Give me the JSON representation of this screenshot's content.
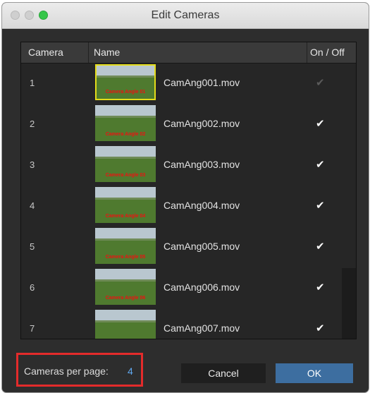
{
  "window": {
    "title": "Edit Cameras"
  },
  "table": {
    "columns": {
      "camera": "Camera",
      "name": "Name",
      "on_off": "On / Off"
    },
    "rows": [
      {
        "camera": "1",
        "name": "CamAng001.mov",
        "thumb_caption": "Camera Angle 01",
        "checked": true,
        "selected": true
      },
      {
        "camera": "2",
        "name": "CamAng002.mov",
        "thumb_caption": "Camera Angle 02",
        "checked": true,
        "selected": false
      },
      {
        "camera": "3",
        "name": "CamAng003.mov",
        "thumb_caption": "Camera Angle 03",
        "checked": true,
        "selected": false
      },
      {
        "camera": "4",
        "name": "CamAng004.mov",
        "thumb_caption": "Camera Angle 04",
        "checked": true,
        "selected": false
      },
      {
        "camera": "5",
        "name": "CamAng005.mov",
        "thumb_caption": "Camera Angle 05",
        "checked": true,
        "selected": false
      },
      {
        "camera": "6",
        "name": "CamAng006.mov",
        "thumb_caption": "Camera Angle 06",
        "checked": true,
        "selected": false
      },
      {
        "camera": "7",
        "name": "CamAng007.mov",
        "thumb_caption": "",
        "checked": true,
        "selected": false
      }
    ]
  },
  "footer": {
    "cameras_per_page_label": "Cameras per page:",
    "cameras_per_page_value": "4",
    "cancel_label": "Cancel",
    "ok_label": "OK"
  },
  "colors": {
    "highlight_box": "#e32b2b",
    "ok_button": "#3d6ea0",
    "value_text": "#5fa8f0",
    "selected_thumb_border": "#e4dc1a"
  }
}
